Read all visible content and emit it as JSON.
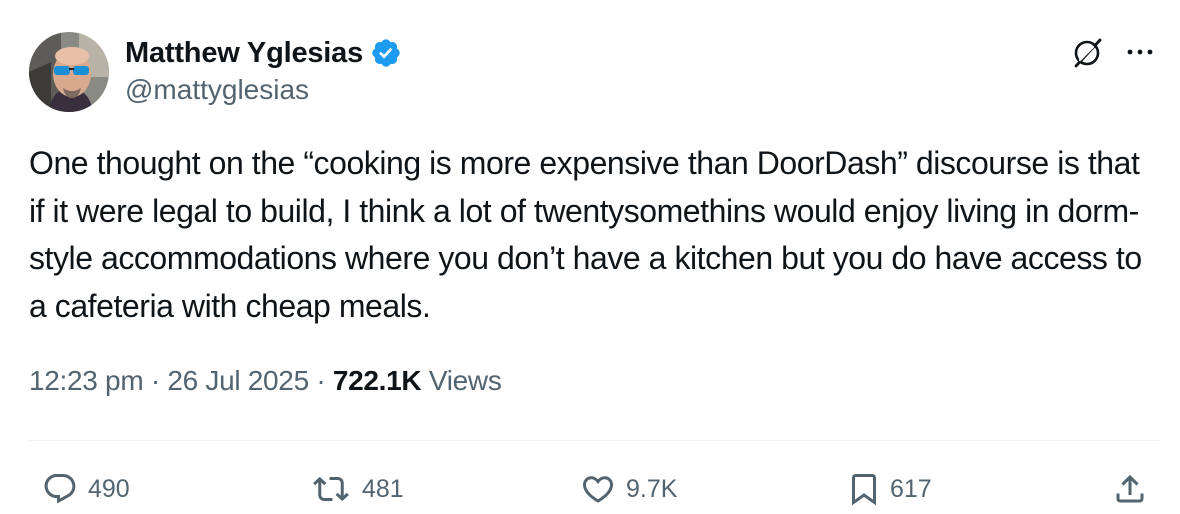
{
  "author": {
    "display_name": "Matthew Yglesias",
    "handle": "@mattyglesias",
    "verified": true,
    "avatar_icon": "avatar-photo"
  },
  "header_icons": {
    "grok": "grok-icon",
    "more": "more-options-icon"
  },
  "tweet": {
    "text": "One thought on the “cooking is more expensive than DoorDash” discourse is that if it were legal to build, I think a lot of twentysomethins would enjoy living in dorm-style accommodations where you don’t have a kitchen but you do have access to a cafeteria with cheap meals."
  },
  "meta": {
    "time": "12:23 pm",
    "separator": "·",
    "date": "26 Jul 2025",
    "views_count": "722.1K",
    "views_label": "Views"
  },
  "actions": {
    "replies": "490",
    "reposts": "481",
    "likes": "9.7K",
    "bookmarks": "617"
  },
  "colors": {
    "text_primary": "#0f1419",
    "text_secondary": "#536471",
    "verified_blue": "#1d9bf0",
    "divider": "#eff3f4"
  }
}
